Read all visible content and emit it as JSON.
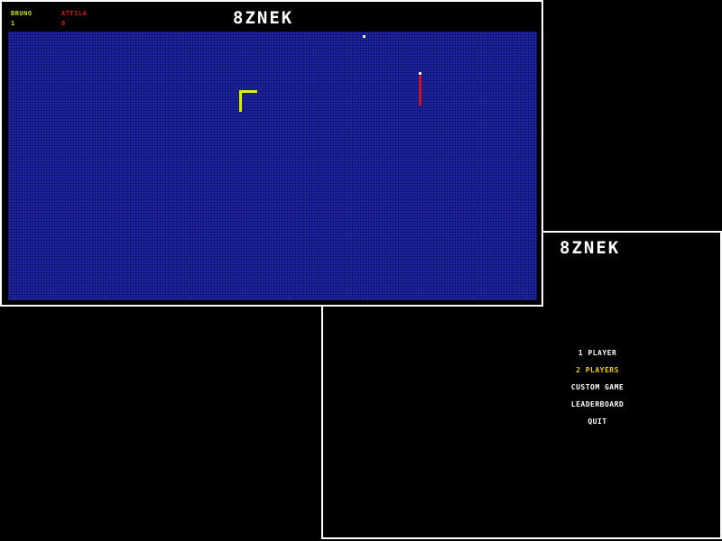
{
  "menu": {
    "title": "8ZNEK",
    "items": [
      {
        "label": "1 PLAYER",
        "selected": false
      },
      {
        "label": "2 PLAYERS",
        "selected": true
      },
      {
        "label": "CUSTOM GAME",
        "selected": false
      },
      {
        "label": "LEADERBOARD",
        "selected": false
      },
      {
        "label": "QUIT",
        "selected": false
      }
    ]
  },
  "game": {
    "title": "8ZNEK",
    "players": [
      {
        "name": "BRUNO",
        "score": "1",
        "color": "#c8e000"
      },
      {
        "name": "ATTILA",
        "score": "0",
        "color": "#e01818"
      }
    ],
    "field_color": "#1f26a8",
    "snake_colors": {
      "yellow": "#d8f000",
      "red": "#d01020",
      "red_head": "#ffffff"
    },
    "food_color": "#f8f080"
  }
}
